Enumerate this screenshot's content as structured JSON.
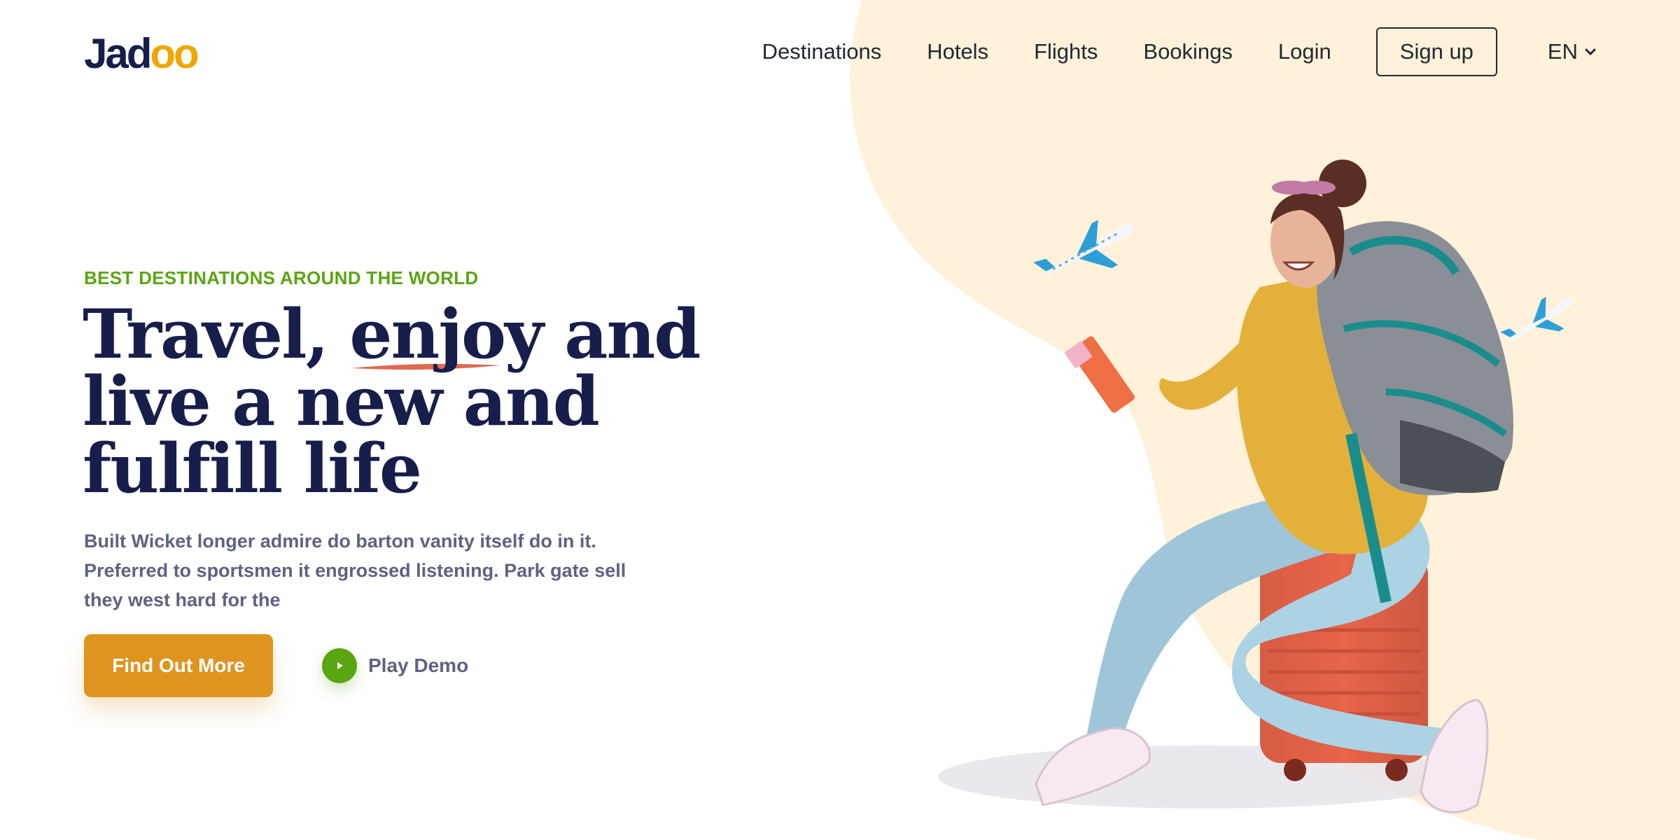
{
  "brand": {
    "logo_prefix": "Jad",
    "logo_suffix": "oo"
  },
  "nav": {
    "links": [
      "Destinations",
      "Hotels",
      "Flights",
      "Bookings",
      "Login"
    ],
    "signup_label": "Sign up",
    "language": "EN"
  },
  "hero": {
    "tagline": "BEST DESTINATIONS AROUND THE WORLD",
    "headline": {
      "line1_a": "Travel,",
      "line1_highlight": "enjoy",
      "line1_b": "and",
      "line2": "live a new and",
      "line3": "fulfill life"
    },
    "description": "Built Wicket longer admire do barton vanity itself do in it. Preferred to sportsmen it engrossed listening. Park gate sell they west hard for the",
    "cta_label": "Find Out More",
    "demo_label": "Play Demo"
  },
  "colors": {
    "accent_orange": "#df9420",
    "accent_green": "#5aa512",
    "headline_navy": "#181e4b",
    "blob_cream": "#fff1da",
    "underline_red": "#df6951"
  },
  "icons": {
    "demo": "play-icon",
    "language": "chevron-down-icon",
    "planes": "airplane-icon"
  }
}
